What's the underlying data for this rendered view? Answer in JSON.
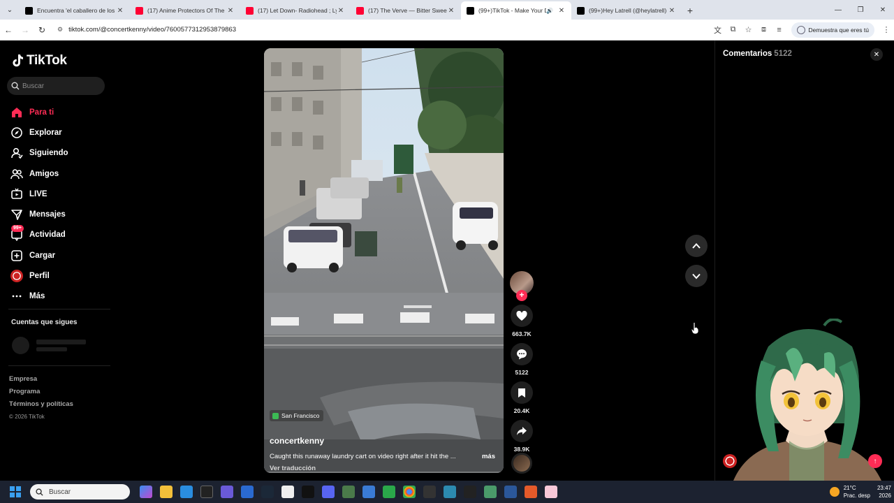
{
  "browser": {
    "tabs": [
      {
        "title": "Encuentra 'el caballero de los 7 reinos'",
        "favicon": "tiktok",
        "active": false
      },
      {
        "title": "(17) Anime Protectors Of The E",
        "favicon": "youtube",
        "active": false
      },
      {
        "title": "(17) Let Down- Radiohead ; Lyri",
        "favicon": "youtube",
        "active": false
      },
      {
        "title": "(17) The Verve — Bitter Sweet S",
        "favicon": "youtube",
        "active": false
      },
      {
        "title": "(99+)TikTok - Make Your Da",
        "favicon": "tiktok",
        "active": true
      },
      {
        "title": "(99+)Hey Latrell (@heylatrell) |",
        "favicon": "tiktok",
        "active": false
      }
    ],
    "url": "tiktok.com/@concertkenny/video/7600577312953879863",
    "profile_chip": "Demuestra que eres tú"
  },
  "sidebar": {
    "logo": "TikTok",
    "search_placeholder": "Buscar",
    "nav": [
      {
        "label": "Para ti",
        "icon": "home-icon",
        "active": true
      },
      {
        "label": "Explorar",
        "icon": "compass-icon"
      },
      {
        "label": "Siguiendo",
        "icon": "following-icon"
      },
      {
        "label": "Amigos",
        "icon": "friends-icon"
      },
      {
        "label": "LIVE",
        "icon": "live-icon"
      },
      {
        "label": "Mensajes",
        "icon": "messages-icon"
      },
      {
        "label": "Actividad",
        "icon": "activity-icon",
        "badge": "99+"
      },
      {
        "label": "Cargar",
        "icon": "upload-icon"
      },
      {
        "label": "Perfil",
        "icon": "profile-avatar"
      },
      {
        "label": "Más",
        "icon": "more-icon"
      }
    ],
    "following_title": "Cuentas que sigues",
    "footer": [
      "Empresa",
      "Programa",
      "Términos y políticas"
    ],
    "copyright": "© 2026 TikTok"
  },
  "video": {
    "location": "San Francisco",
    "author": "concertkenny",
    "caption": "Caught this runaway laundry cart on video right after it hit the ...",
    "more": "más",
    "translate": "Ver traducción"
  },
  "actions": {
    "likes": "663.7K",
    "comments": "5122",
    "saves": "20.4K",
    "shares": "38.9K"
  },
  "comments_panel": {
    "title": "Comentarios",
    "count": "5122"
  },
  "taskbar": {
    "search_placeholder": "Buscar",
    "weather_temp": "21°C",
    "weather_desc": "Prac. desp",
    "time": "23:47",
    "date": "2026"
  }
}
